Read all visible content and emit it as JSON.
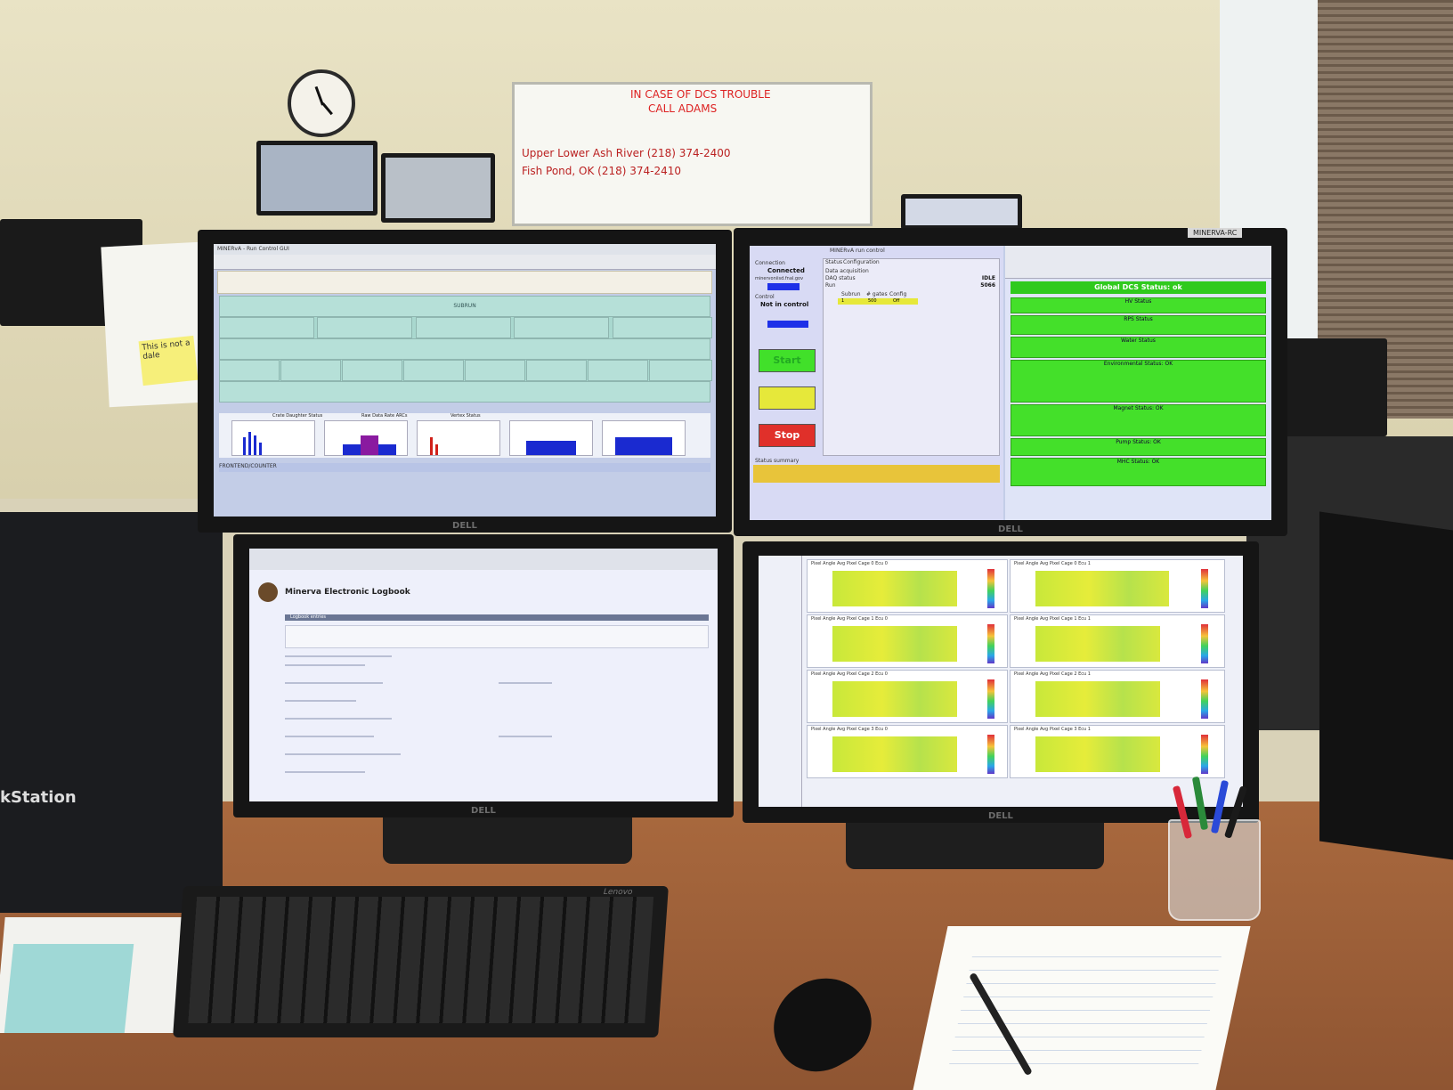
{
  "whiteboard": {
    "lines": [
      "IN CASE OF DCS TROUBLE",
      "CALL ADAMS",
      "Upper Lower Ash River (218) 374-2400",
      "Fish Pond, OK (218) 374-2410"
    ]
  },
  "sticky_note": "This is not a dale",
  "top_left_screen": {
    "title": "MINERvA - Run Control GUI",
    "status_bar": "FRONTEND/COUNTER",
    "row_label_top": "SUBRUN",
    "hist_labels": [
      "Crate Daughter Status",
      "Raw Data Rate ARCs",
      "Vertex Status"
    ]
  },
  "top_right_screen": {
    "left_title": "MINERvA run control",
    "connection_label": "Connection",
    "connected": "Connected",
    "host": "minervoniisd.fnal.gov",
    "control_label": "Control",
    "not_in_control": "Not in control",
    "status_tab": "Status",
    "config_tab": "Configuration",
    "data_acq_label": "Data acquisition",
    "daq_status_label": "DAQ status",
    "daq_status": "IDLE",
    "run_label": "Run",
    "run_number": "5066",
    "subrun_header": "Subrun",
    "gates_header": "# gates",
    "config_header": "Config",
    "subrun_val": "1",
    "gates_val": "500",
    "config_val": "Off",
    "start_label": "Start",
    "stop_label": "Stop",
    "status_summary": "Status summary",
    "right_title": "Global DCS Status: ok",
    "tab_label": "MINERVA-RC",
    "dcs_rows": [
      "HV Status",
      "RPS Status",
      "Water Status",
      "Environmental Status: OK",
      "Magnet Status: OK",
      "Pump Status: OK",
      "MHC Status: OK"
    ]
  },
  "bottom_left_screen": {
    "title": "Minerva Electronic Logbook",
    "section": "Logbook entries"
  },
  "bottom_right_screen": {
    "panel_titles": [
      "Pixel Angle Avg Pixel Cage 0 Ecu 0",
      "Pixel Angle Avg Pixel Cage 0 Ecu 1",
      "Pixel Angle Avg Pixel Cage 1 Ecu 0",
      "Pixel Angle Avg Pixel Cage 1 Ecu 1",
      "Pixel Angle Avg Pixel Cage 2 Ecu 0",
      "Pixel Angle Avg Pixel Cage 2 Ecu 1",
      "Pixel Angle Avg Pixel Cage 3 Ecu 0",
      "Pixel Angle Avg Pixel Cage 3 Ecu 1"
    ]
  },
  "monitor_brand": "DELL",
  "keyboard_brand": "Lenovo",
  "tower_label": "kStation"
}
